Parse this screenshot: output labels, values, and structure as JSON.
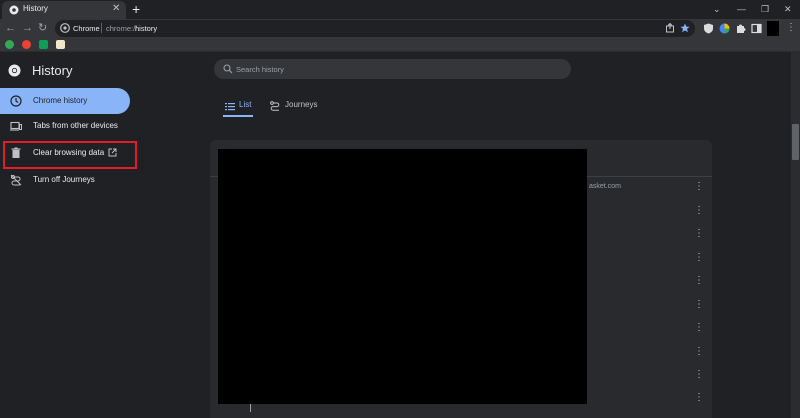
{
  "browser": {
    "tab_title": "History",
    "tab_close": "✕",
    "new_tab": "+",
    "window_controls": [
      "⌄",
      "—",
      "❐",
      "✕"
    ],
    "nav": {
      "back": "←",
      "forward": "→",
      "reload": "↻"
    },
    "omnibox": {
      "site": "Chrome",
      "scheme": "chrome://",
      "path": "history"
    },
    "toolbar_icons": [
      "share-icon",
      "bookmark-star-icon",
      "extension-a-icon",
      "extension-b-icon",
      "extensions-puzzle-icon",
      "side-panel-icon",
      "profile-icon",
      "menu-icon"
    ],
    "bookmarks": [
      {
        "icon": "bookmark-1-icon",
        "color": "#34a853"
      },
      {
        "icon": "bookmark-2-icon",
        "color": "#ea4335"
      },
      {
        "icon": "bookmark-3-icon",
        "color": "#0f9d58"
      },
      {
        "icon": "bookmark-4-icon",
        "color": "#f1e7c8"
      }
    ]
  },
  "history": {
    "title": "History",
    "search_placeholder": "Search history",
    "sidebar": [
      {
        "label": "Chrome history",
        "icon": "clock-icon",
        "selected": true
      },
      {
        "label": "Tabs from other devices",
        "icon": "devices-icon",
        "selected": false
      },
      {
        "label": "Clear browsing data",
        "icon": "trash-icon",
        "selected": false,
        "external": true
      },
      {
        "label": "Turn off Journeys",
        "icon": "journeys-off-icon",
        "selected": false
      }
    ],
    "tabs": [
      {
        "label": "List",
        "icon": "list-icon",
        "selected": true
      },
      {
        "label": "Journeys",
        "icon": "journeys-icon",
        "selected": false
      }
    ],
    "visible_partial_text": "asket.com",
    "row_menu_glyph": "⋮"
  },
  "colors": {
    "accent": "#8ab4f8",
    "highlight": "#e01e2a",
    "background": "#202124",
    "card": "#292a2d"
  }
}
